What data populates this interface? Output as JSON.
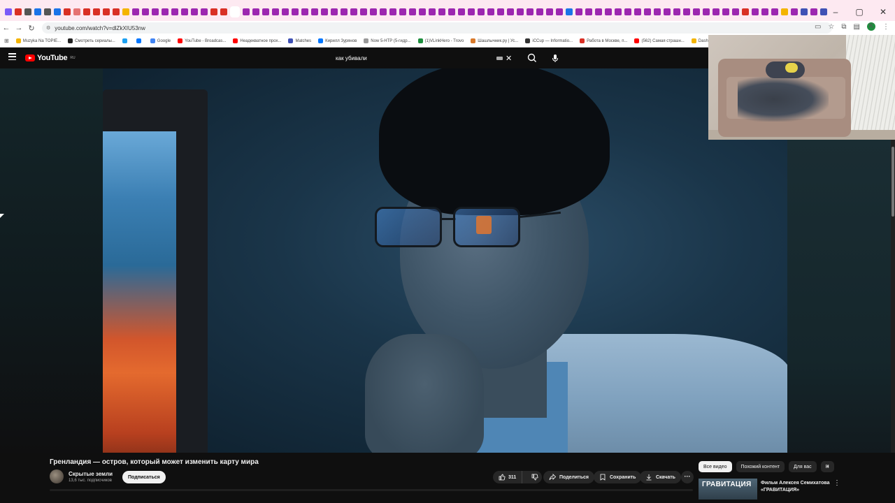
{
  "browser": {
    "tab_colors": [
      "#7a5af8",
      "#d93025",
      "#555",
      "#1a73e8",
      "#555",
      "#1a73e8",
      "#d93025",
      "#e57373",
      "#d93025",
      "#d93025",
      "#d93025",
      "#d93025",
      "#f4b400",
      "#9c27b0",
      "#9c27b0",
      "#9c27b0",
      "#9c27b0",
      "#9c27b0",
      "#9c27b0",
      "#9c27b0",
      "#9c27b0",
      "#d93025",
      "#d93025"
    ],
    "more_tab_colors": [
      "#9c27b0",
      "#9c27b0",
      "#9c27b0",
      "#9c27b0",
      "#9c27b0",
      "#9c27b0",
      "#9c27b0",
      "#9c27b0",
      "#9c27b0",
      "#9c27b0",
      "#9c27b0",
      "#9c27b0",
      "#9c27b0",
      "#9c27b0",
      "#9c27b0",
      "#9c27b0",
      "#9c27b0",
      "#9c27b0",
      "#9c27b0",
      "#9c27b0",
      "#9c27b0",
      "#9c27b0",
      "#9c27b0",
      "#9c27b0",
      "#9c27b0",
      "#9c27b0",
      "#9c27b0",
      "#9c27b0",
      "#9c27b0",
      "#9c27b0",
      "#9c27b0",
      "#9c27b0",
      "#9c27b0",
      "#9c27b0",
      "#1a73e8",
      "#9c27b0",
      "#9c27b0",
      "#9c27b0",
      "#9c27b0",
      "#9c27b0",
      "#9c27b0",
      "#9c27b0",
      "#9c27b0",
      "#9c27b0",
      "#9c27b0",
      "#9c27b0",
      "#9c27b0",
      "#9c27b0",
      "#9c27b0",
      "#9c27b0",
      "#9c27b0",
      "#9c27b0",
      "#d93025",
      "#9c27b0",
      "#9c27b0",
      "#9c27b0",
      "#f4b400",
      "#9c27b0",
      "#3f51b5",
      "#9c27b0",
      "#3f51b5",
      "#333",
      "#333",
      "#333",
      "#333",
      "#1e8e3e",
      "#333",
      "#1a73e8",
      "#d93025",
      "#d93025",
      "#9c27b0",
      "#4285f4"
    ],
    "new_tab_label": "+",
    "window_controls": [
      "–",
      "▢",
      "✕"
    ],
    "url": "youtube.com/watch?v=dlZkXIU53nw",
    "profile_initial": "K"
  },
  "bookmarks": [
    {
      "label": "Muzyka Na TOPIE...",
      "color": "#f4b400"
    },
    {
      "label": "Смотреть сериалы...",
      "color": "#222"
    },
    {
      "label": "",
      "color": "#1da1f2"
    },
    {
      "label": "",
      "color": "#0077ff"
    },
    {
      "label": "Google",
      "color": "#4285f4"
    },
    {
      "label": "YouTube - Broadcas...",
      "color": "#ff0000"
    },
    {
      "label": "Неадекватное прох...",
      "color": "#ff0000"
    },
    {
      "label": "Matches",
      "color": "#3f51b5"
    },
    {
      "label": "Кирилл Зурянов",
      "color": "#0077ff"
    },
    {
      "label": "Now 5-HTP (5-гидр...",
      "color": "#999"
    },
    {
      "label": "(1)VLinkHero - Trovo",
      "color": "#1e8e3e"
    },
    {
      "label": "Шашлычник.ру | Ус...",
      "color": "#d97a2b"
    },
    {
      "label": "iCCup — Informatio...",
      "color": "#333"
    },
    {
      "label": "Работа в Москве, п...",
      "color": "#d93025"
    },
    {
      "label": "(562) Самая страшн...",
      "color": "#ff0000"
    },
    {
      "label": "Dash",
      "color": "#f4b400"
    }
  ],
  "youtube": {
    "logo_text": "YouTube",
    "logo_region": "RU",
    "search_query": "как убивали",
    "video": {
      "title": "Гренландия — остров, который может изменить карту мира",
      "channel": "Скрытые земли",
      "subscribers": "13,6 тыс. подписчиков",
      "subscribe_label": "Подписаться",
      "likes": "311",
      "share_label": "Поделиться",
      "save_label": "Сохранить",
      "download_label": "Скачать",
      "more_label": "···"
    },
    "chips": [
      "Все видео",
      "Похожий контент",
      "Для вас",
      "Н"
    ],
    "recommendation": {
      "thumb_text": "ГРАВИТАЦИЯ",
      "title": "Фильм Алексея Семихатова «ГРАВИТАЦИЯ»"
    }
  }
}
